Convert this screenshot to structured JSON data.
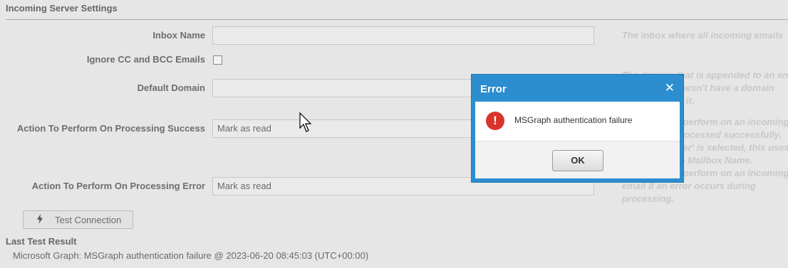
{
  "section": {
    "title": "Incoming Server Settings"
  },
  "fields": {
    "inbox_name": {
      "label": "Inbox Name",
      "value": ""
    },
    "ignore_cc": {
      "label": "Ignore CC and BCC Emails",
      "checked": false
    },
    "default_domain": {
      "label": "Default Domain",
      "value": ""
    },
    "success_action": {
      "label": "Action To Perform On Processing Success",
      "value": "Mark as read"
    },
    "error_action": {
      "label": "Action To Perform On Processing Error",
      "value": "Mark as read"
    }
  },
  "help": [
    "The inbox where all incoming emails",
    "The domain that is appended to an en",
    "doesn't have a domain",
    "th it.",
    "o perform on an incoming",
    "processed successfully.",
    "lder' is selected, this uses",
    "ve Mailbox Name.",
    "o perform on an incoming",
    "email if an error occurs during",
    "processing."
  ],
  "test_button": {
    "label": "Test Connection",
    "icon": "lightning-bolt-icon"
  },
  "last_test": {
    "title": "Last Test Result",
    "text": "Microsoft Graph: MSGraph authentication failure @ 2023-06-20 08:45:03 (UTC+00:00)"
  },
  "dialog": {
    "title": "Error",
    "close": "✕",
    "icon_glyph": "!",
    "message": "MSGraph authentication failure",
    "ok": "OK"
  },
  "colors": {
    "dialog_header": "#2c8ecf",
    "error_icon": "#d9342b",
    "background": "#e6e6e6"
  }
}
